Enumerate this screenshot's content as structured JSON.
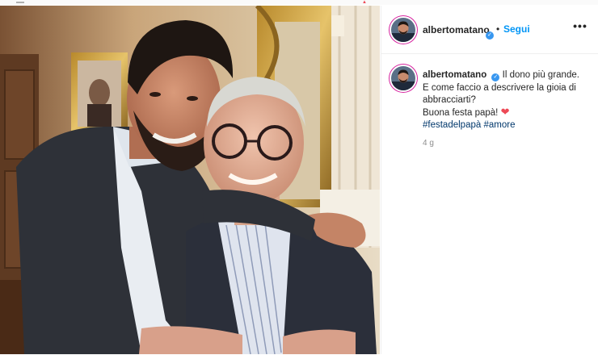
{
  "post": {
    "username": "albertomatano",
    "follow_label": "Segui",
    "separator": "•",
    "more_label": "•••",
    "caption": {
      "username": "albertomatano",
      "line1": "Il dono più grande.",
      "line2": "E come faccio a descrivere la gioia di",
      "line3": "abbracciarti?",
      "line4": "Buona festa papà!",
      "heart": "❤",
      "hashtag1": "#festadelpapà",
      "hashtag2": "#amore"
    },
    "timestamp": "4 g"
  },
  "icons": {
    "verified": "verified-badge-icon",
    "heart": "heart-emoji-icon",
    "more": "more-options-icon"
  },
  "colors": {
    "accent_blue": "#0095f6",
    "verified_blue": "#3897f0",
    "hashtag_blue": "#00376b",
    "heart_red": "#ed4956",
    "text": "#262626",
    "muted": "#8e8e8e"
  }
}
